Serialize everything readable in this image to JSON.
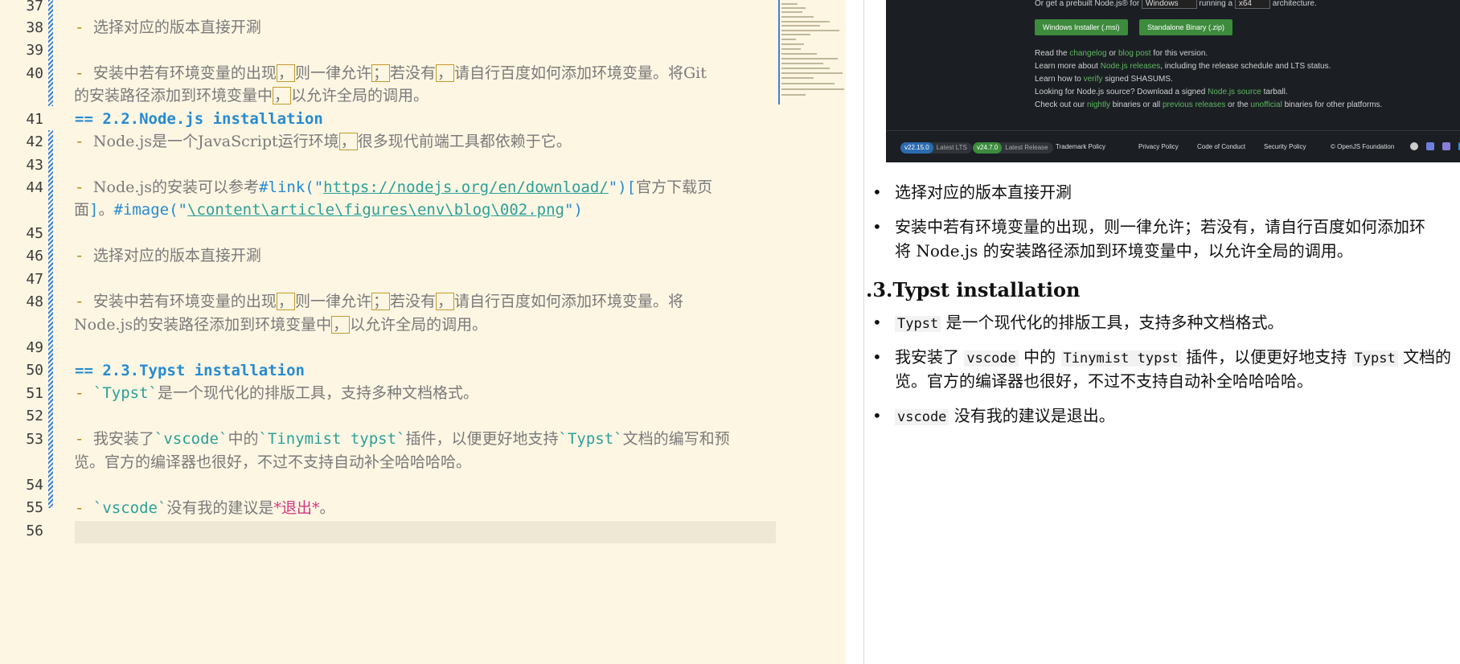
{
  "editor": {
    "line_numbers": [
      "37",
      "38",
      "39",
      "40",
      "41",
      "42",
      "43",
      "44",
      "45",
      "46",
      "47",
      "48",
      "49",
      "50",
      "51",
      "52",
      "53",
      "54",
      "55",
      "56"
    ],
    "l38": "选择对应的版本直接开涮",
    "l40_a": "安装中若有环境变量的出现",
    "l40_b": "则一律允许",
    "l40_c": "若没有",
    "l40_d": "请自行百度如何添加环境变量。将Git",
    "l40_e": "的安装路径添加到环境变量中",
    "l40_f": "以允许全局的调用。",
    "l41": "== 2.2.Node.js installation",
    "l42_a": "Node.js是一个JavaScript运行环境",
    "l42_b": "很多现代前端工具都依赖于它。",
    "l44_a": "Node.js的安装可以参考",
    "l44_kw": "#link(\"",
    "l44_url": "https://nodejs.org/en/download/",
    "l44_close": "\")[",
    "l44_text": "官方下载页",
    "l44_b_text": "面",
    "l44_b_close": "]",
    "l44_b_sep": "。",
    "l44_b_kw": "#image(\"",
    "l44_b_path": "\\content\\article\\figures\\env\\blog\\002.png",
    "l44_b_end": "\")",
    "l46": "选择对应的版本直接开涮",
    "l48_a": "安装中若有环境变量的出现",
    "l48_b": "则一律允许",
    "l48_c": "若没有",
    "l48_d": "请自行百度如何添加环境变量。将",
    "l48_e": "Node.js的安装路径添加到环境变量中",
    "l48_f": "以允许全局的调用。",
    "l50": "== 2.3.Typst installation",
    "l51_code": "`Typst`",
    "l51_rest": "是一个现代化的排版工具，支持多种文档格式。",
    "l53_a": "我安装了",
    "l53_c1": "`vscode`",
    "l53_b": "中的",
    "l53_c2": "`Tinymist typst`",
    "l53_c": "插件，以便更好地支持",
    "l53_c3": "`Typst`",
    "l53_d": "文档的编写和预",
    "l53_e": "览。官方的编译器也很好，不过不支持自动补全哈哈哈哈。",
    "l55_code": "`vscode`",
    "l55_a": "没有我的建议是",
    "l55_emph": "*退出*",
    "l55_b": "。",
    "dash": "-",
    "comma": "，",
    "semi": "；"
  },
  "preview_screenshot": {
    "row1_a": "Or get a prebuilt Node.js® for",
    "os_select": "Windows",
    "row1_b": "running a",
    "arch_select": "x64",
    "row1_c": "architecture.",
    "btn_msi": "Windows Installer (.msi)",
    "btn_zip": "Standalone Binary (.zip)",
    "read_a": "Read the",
    "changelog": "changelog",
    "read_or": "or",
    "blog_post": "blog post",
    "read_b": "for this version.",
    "learn_a": "Learn more about",
    "releases": "Node.js releases",
    "learn_b": ", including the release schedule and LTS status.",
    "verify_a": "Learn how to",
    "verify": "verify",
    "verify_b": "signed SHASUMS.",
    "src_a": "Looking for Node.js source? Download a signed",
    "src_link": "Node.js source",
    "src_b": "tarball.",
    "check_a": "Check out our",
    "nightly": "nightly",
    "check_b": "binaries or all",
    "previous": "previous releases",
    "check_c": "or the",
    "unofficial": "unofficial",
    "check_d": "binaries for other platforms.",
    "lts_ver": "v22.15.0",
    "lts_label": "Latest LTS",
    "cur_ver": "v24.7.0",
    "cur_label": "Latest Release",
    "f1": "Trademark Policy",
    "f2": "Privacy Policy",
    "f3": "Code of Conduct",
    "f4": "Security Policy",
    "copyright": "© OpenJS Foundation"
  },
  "preview": {
    "bullet": "•",
    "b1": "选择对应的版本直接开涮",
    "b2_line1": "安装中若有环境变量的出现，则一律允许；若没有，请自行百度如何添加环",
    "b2_line2": "将 Node.js 的安装路径添加到环境变量中，以允许全局的调用。",
    "heading": ".3.Typst installation",
    "b3_code": "Typst",
    "b3_text": "是一个现代化的排版工具，支持多种文档格式。",
    "b4_a": "我安装了",
    "b4_c1": "vscode",
    "b4_b": "中的",
    "b4_c2": "Tinymist typst",
    "b4_c": "插件，以便更好地支持",
    "b4_c3": "Typst",
    "b4_d": "文档的",
    "b4_line2": "览。官方的编译器也很好，不过不支持自动补全哈哈哈哈。",
    "b5_code": "vscode",
    "b5_text": "没有我的建议是退出。"
  },
  "colors": {
    "editor_bg": "#fdf6e3",
    "heading": "#268bd2",
    "link": "#2aa198",
    "emphasis": "#d33682",
    "dash": "#b58900"
  }
}
